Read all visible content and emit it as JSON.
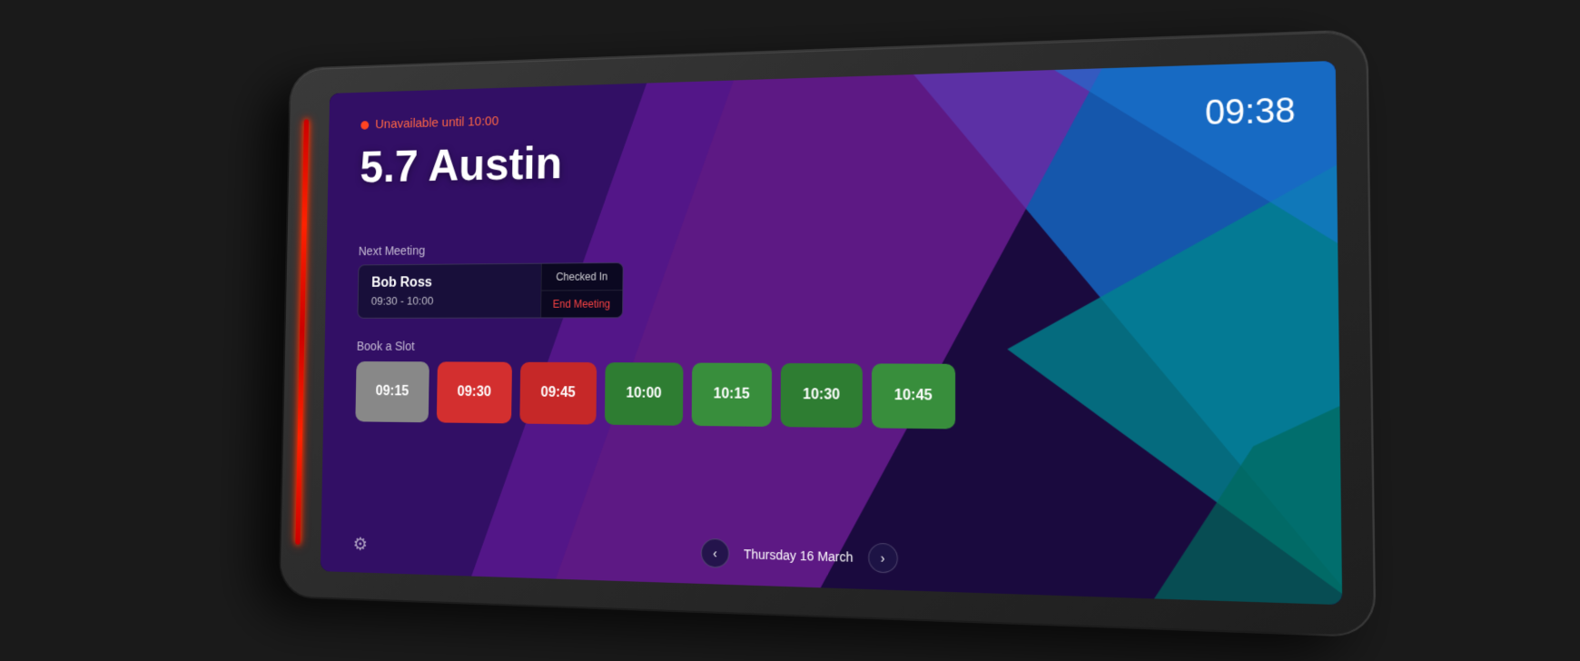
{
  "screen": {
    "status": {
      "dot_color": "#ff4422",
      "text": "Unavailable until 10:00"
    },
    "room_name": "5.7 Austin",
    "current_time": "09:38",
    "next_meeting": {
      "label": "Next Meeting",
      "meeting_name": "Bob Ross",
      "meeting_time": "09:30 - 10:00",
      "checked_in_label": "Checked In",
      "end_meeting_label": "End Meeting"
    },
    "book_slot": {
      "label": "Book a Slot",
      "slots": [
        {
          "time": "09:15",
          "type": "gray"
        },
        {
          "time": "09:30",
          "type": "red"
        },
        {
          "time": "09:45",
          "type": "red2"
        },
        {
          "time": "10:00",
          "type": "green"
        },
        {
          "time": "10:15",
          "type": "green2"
        },
        {
          "time": "10:30",
          "type": "green3"
        },
        {
          "time": "10:45",
          "type": "green4"
        }
      ]
    },
    "date_nav": {
      "prev_label": "‹",
      "next_label": "›",
      "current_date": "Thursday 16 March"
    },
    "settings_icon": "⚙"
  }
}
